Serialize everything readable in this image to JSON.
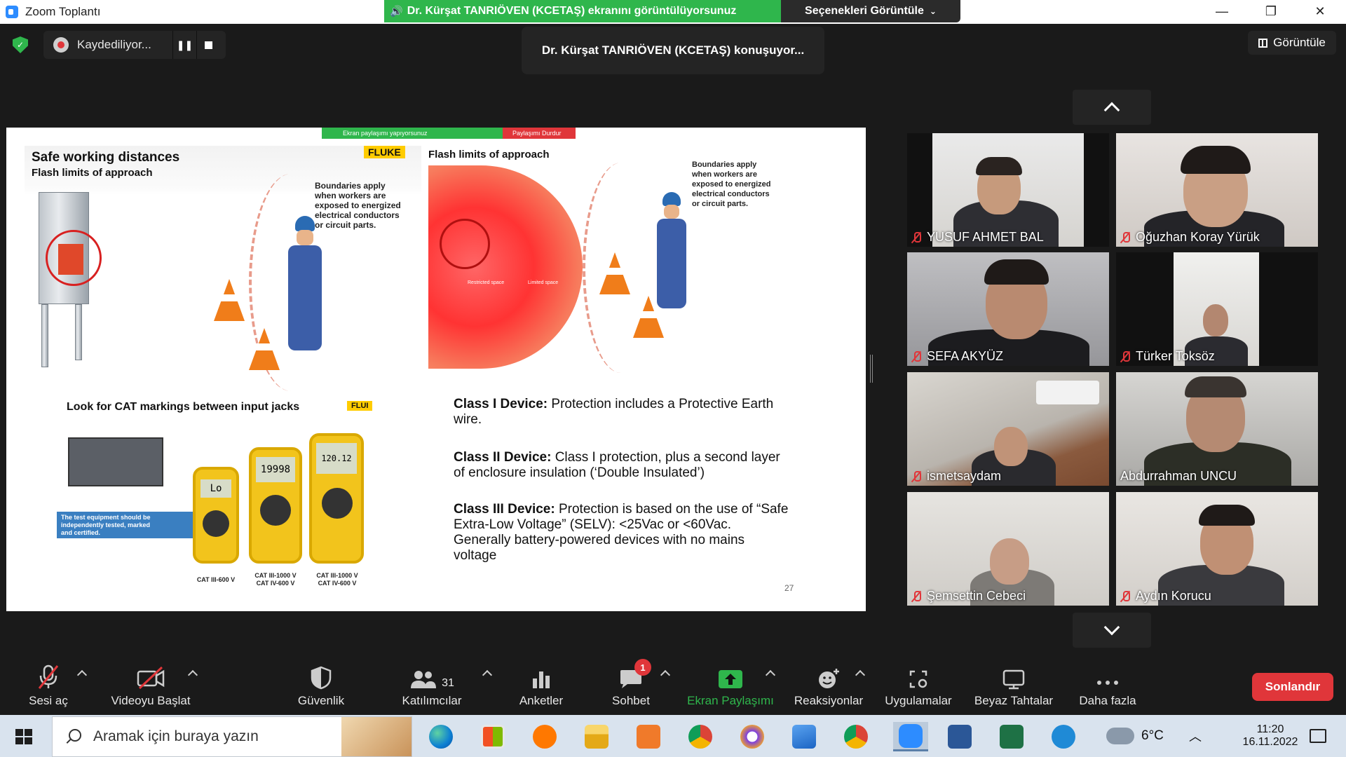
{
  "window": {
    "title": "Zoom Toplantı",
    "share_banner": "Dr. Kürşat TANRIÖVEN (KCETAŞ) ekranını görüntülüyorsunuz",
    "view_options": "Seçenekleri Görüntüle"
  },
  "meeting": {
    "recording_label": "Kaydediliyor...",
    "speaking_label": "Dr. Kürşat TANRIÖVEN (KCETAŞ) konuşuyor...",
    "view_label": "Görüntüle"
  },
  "slide": {
    "mini_banner": "Ekran paylaşımı yapıyorsunuz",
    "mini_stop": "Paylaşımı Durdur",
    "panel_a_title": "Safe working distances",
    "panel_a_subtitle": "Flash limits of approach",
    "panel_a_logo": "FLUKE",
    "panel_a_note": [
      "Boundaries apply",
      "when workers are",
      "exposed to energized",
      "electrical conductors",
      "or circuit parts."
    ],
    "panel_b_title": "Flash limits of approach",
    "panel_b_note": [
      "Boundaries apply",
      "when workers are",
      "exposed to energized",
      "electrical conductors",
      "or circuit parts."
    ],
    "panel_b_spaces": [
      "Restricted space",
      "Limited space"
    ],
    "cat_title": "Look for CAT markings between input jacks",
    "cat_logo": "FLUI",
    "cat_note": [
      "The test equipment should be",
      "independently tested, marked",
      "and certified."
    ],
    "cat_labels": [
      "CAT III-600 V",
      "CAT III-1000 V\nCAT IV-600 V",
      "CAT III-1000 V\nCAT IV-600 V"
    ],
    "meter_readings": [
      "Lo",
      "19998",
      "120.12"
    ],
    "class1_head": "Class I Device:",
    "class1_body": " Protection includes a Protective Earth wire.",
    "class2_head": "Class II Device:",
    "class2_body": " Class I protection, plus a second layer of enclosure insulation (‘Double Insulated’)",
    "class3_head": "Class III Device:",
    "class3_body": " Protection is based on the use of “Safe Extra-Low Voltage” (SELV): <25Vac or <60Vac. Generally battery-powered devices with no mains voltage",
    "page_number": "27"
  },
  "participants": [
    {
      "name": "YUSUF AHMET BAL",
      "muted": true
    },
    {
      "name": "Oğuzhan Koray Yürük",
      "muted": true
    },
    {
      "name": "SEFA AKYÜZ",
      "muted": true
    },
    {
      "name": "Türker Toksöz",
      "muted": true
    },
    {
      "name": "ismetsaydam",
      "muted": true
    },
    {
      "name": "Abdurrahman UNCU",
      "muted": false
    },
    {
      "name": "Şemsettin Cebeci",
      "muted": true
    },
    {
      "name": "Aydın Korucu",
      "muted": true
    }
  ],
  "toolbar": {
    "unmute": "Sesi aç",
    "start_video": "Videoyu Başlat",
    "security": "Güvenlik",
    "participants": "Katılımcılar",
    "participants_count": "31",
    "polls": "Anketler",
    "chat": "Sohbet",
    "chat_badge": "1",
    "share_screen": "Ekran Paylaşımı",
    "reactions": "Reaksiyonlar",
    "apps": "Uygulamalar",
    "whiteboards": "Beyaz Tahtalar",
    "more": "Daha fazla",
    "end": "Sonlandır"
  },
  "taskbar": {
    "search_placeholder": "Aramak için buraya yazın",
    "temperature": "6°C",
    "time": "11:20",
    "date": "16.11.2022"
  },
  "colors": {
    "share_green": "#2fb64c",
    "end_red": "#e0363a",
    "zoom_blue": "#2d8cff"
  }
}
